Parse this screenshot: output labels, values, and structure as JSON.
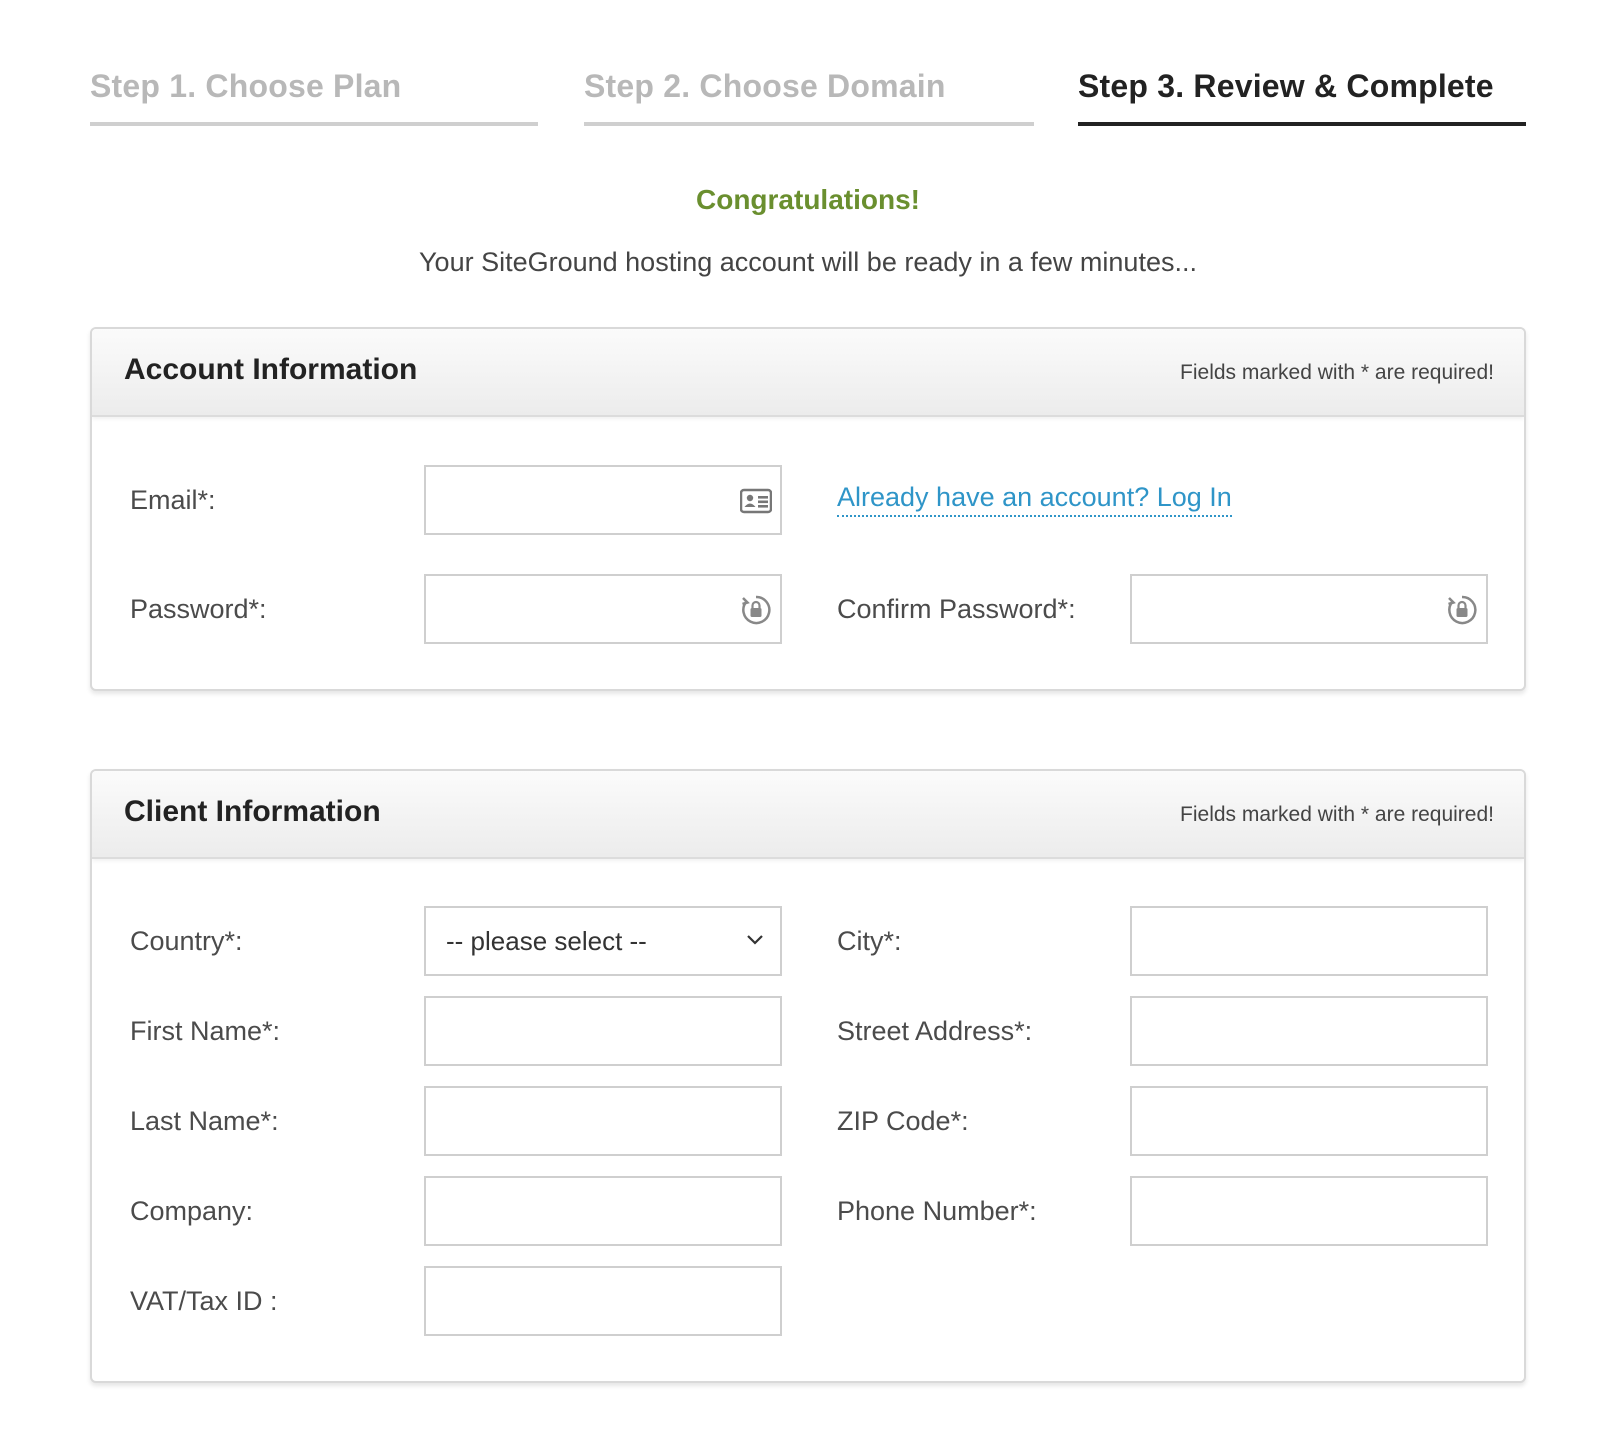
{
  "steps": [
    {
      "label": "Step 1. Choose Plan",
      "state": "inactive"
    },
    {
      "label": "Step 2. Choose Domain",
      "state": "inactive"
    },
    {
      "label": "Step 3. Review & Complete",
      "state": "active"
    }
  ],
  "congrats": "Congratulations!",
  "subtitle": "Your SiteGround hosting account will be ready in a few minutes...",
  "account": {
    "title": "Account Information",
    "required_note": "Fields marked with * are required!",
    "email_label": "Email*:",
    "login_link": "Already have an account? Log In",
    "password_label": "Password*:",
    "confirm_label": "Confirm Password*:"
  },
  "client": {
    "title": "Client Information",
    "required_note": "Fields marked with * are required!",
    "country_label": "Country*:",
    "country_value": "-- please select --",
    "city_label": "City*:",
    "first_name_label": "First Name*:",
    "street_label": "Street Address*:",
    "last_name_label": "Last Name*:",
    "zip_label": "ZIP Code*:",
    "company_label": "Company:",
    "phone_label": "Phone Number*:",
    "vat_label": "VAT/Tax ID :"
  },
  "colors": {
    "congrats": "#6a8f2f",
    "link": "#2f95c8",
    "active_step": "#222222",
    "inactive_step": "#b8b8b8"
  },
  "icons": {
    "email": "contact-card-icon",
    "password": "lock-refresh-icon",
    "select": "chevron-down-icon"
  }
}
